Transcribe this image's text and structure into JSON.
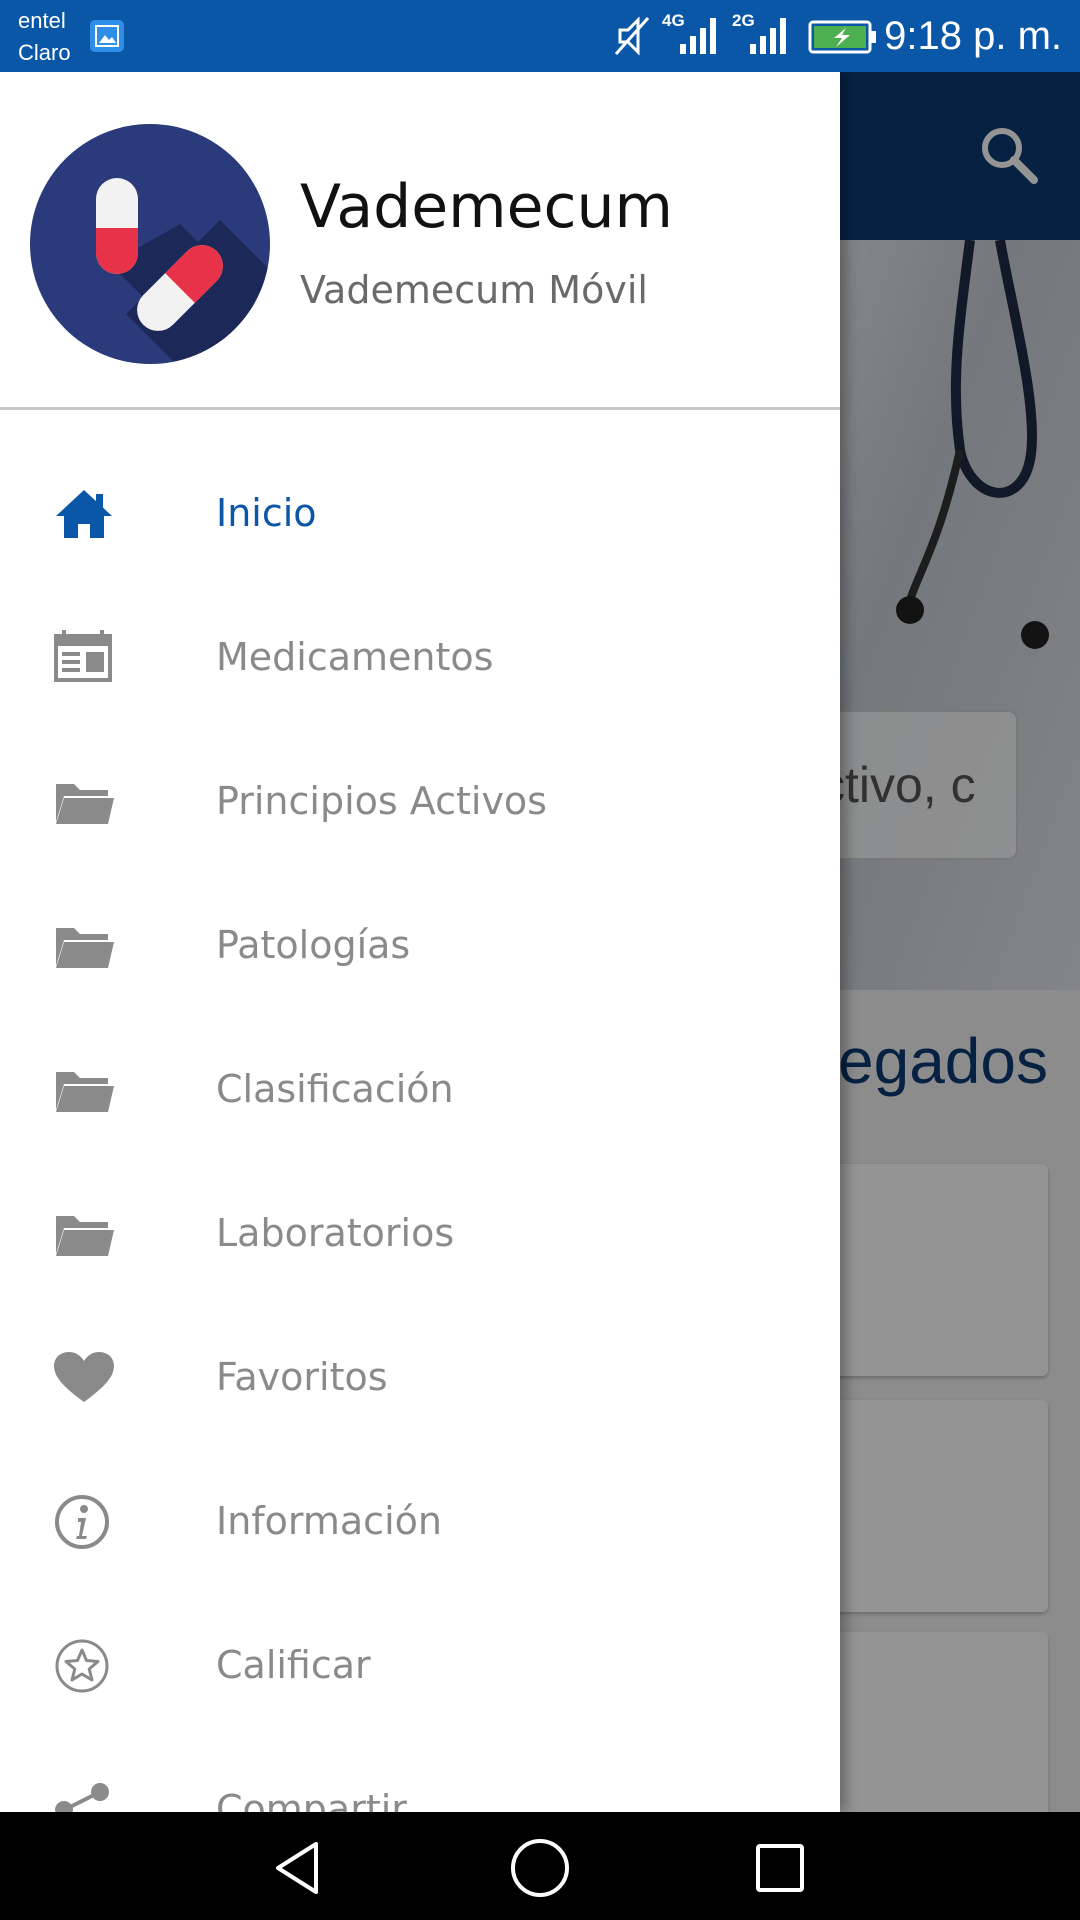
{
  "status_bar": {
    "carrier_1": "entel",
    "carrier_2": "Claro",
    "network_1": "4G",
    "network_2": "2G",
    "time": "9:18 p. m.",
    "icons": [
      "gallery-notification-icon",
      "mute-icon",
      "signal-4g-icon",
      "signal-2g-icon",
      "battery-charging-icon"
    ]
  },
  "drawer": {
    "app_title": "Vademecum",
    "app_subtitle": "Vademecum Móvil",
    "logo_icon": "pills-logo-icon",
    "menu": [
      {
        "label": "Inicio",
        "icon": "home-icon",
        "active": true
      },
      {
        "label": "Medicamentos",
        "icon": "calendar-list-icon",
        "active": false
      },
      {
        "label": "Principios Activos",
        "icon": "folder-icon",
        "active": false
      },
      {
        "label": "Patologías",
        "icon": "folder-icon",
        "active": false
      },
      {
        "label": "Clasificación",
        "icon": "folder-icon",
        "active": false
      },
      {
        "label": "Laboratorios",
        "icon": "folder-icon",
        "active": false
      },
      {
        "label": "Favoritos",
        "icon": "heart-icon",
        "active": false
      },
      {
        "label": "Información",
        "icon": "info-icon",
        "active": false
      },
      {
        "label": "Calificar",
        "icon": "star-circle-icon",
        "active": false
      },
      {
        "label": "Compartir",
        "icon": "share-icon",
        "active": false
      }
    ]
  },
  "background_app": {
    "search_icon": "search-icon",
    "search_partial_text": "ctivo, c",
    "section_partial_title": "egados"
  },
  "colors": {
    "status_bar": "#0a57a8",
    "toolbar": "#0b3a72",
    "active_item": "#0a57a8",
    "inactive_item": "#8a8a8a",
    "logo_bg": "#2a3a7a"
  },
  "navigation_bar": {
    "icons": [
      "back-icon",
      "home-circle-icon",
      "recents-icon"
    ]
  }
}
